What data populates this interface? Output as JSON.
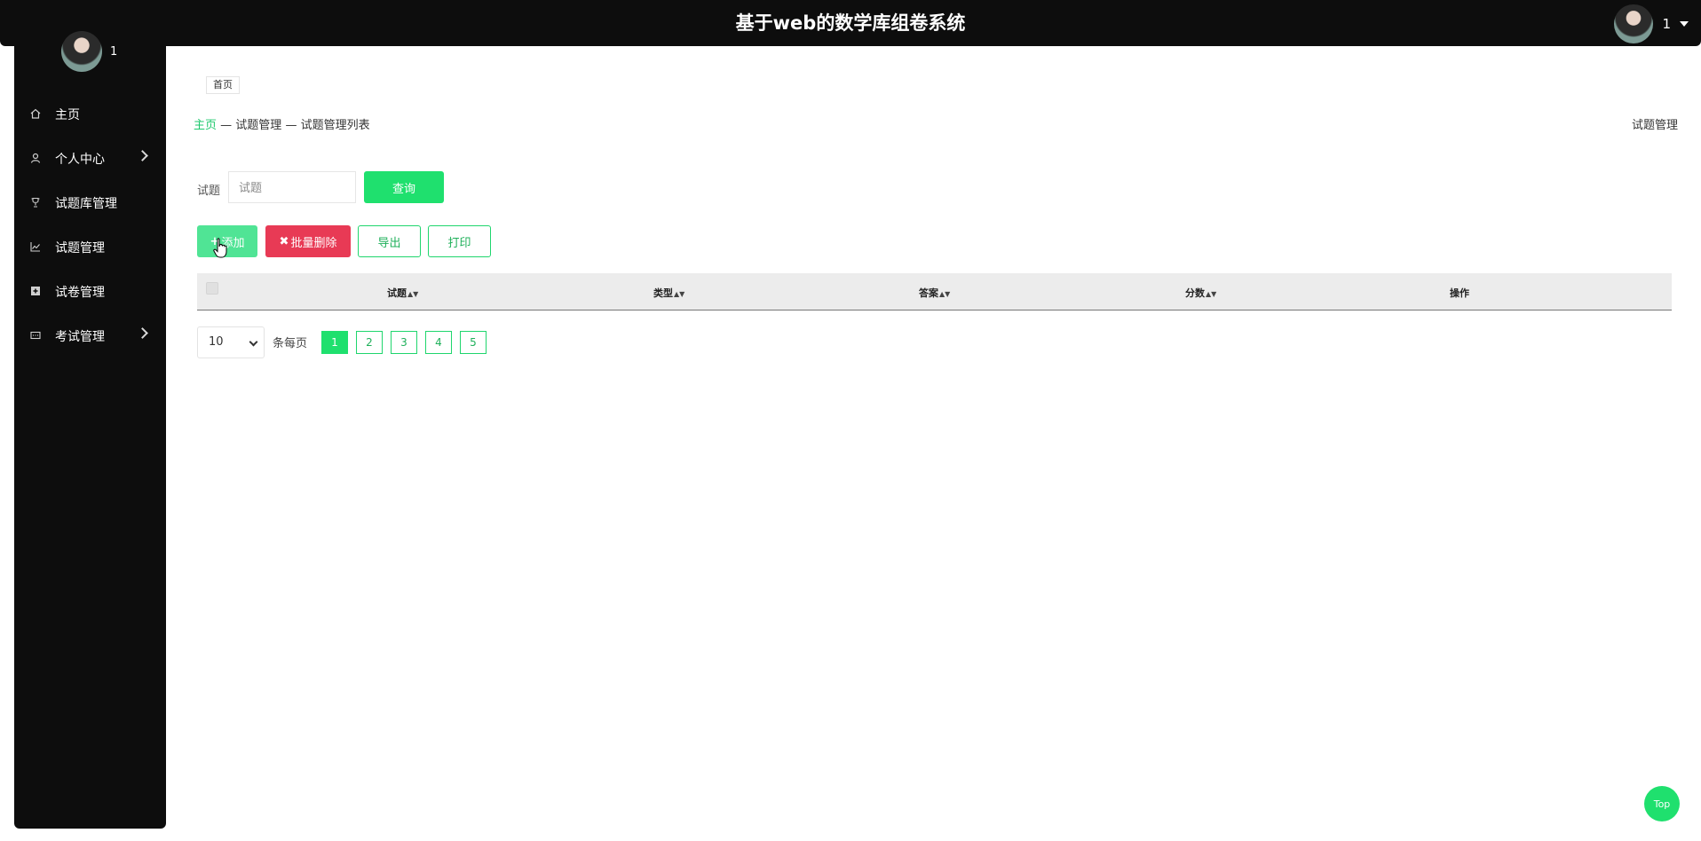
{
  "app": {
    "title": "基于web的数学库组卷系统",
    "username": "1"
  },
  "sidebar": {
    "username": "1",
    "items": [
      {
        "label": "主页",
        "icon": "home-icon",
        "expandable": false
      },
      {
        "label": "个人中心",
        "icon": "user-icon",
        "expandable": true
      },
      {
        "label": "试题库管理",
        "icon": "trophy-icon",
        "expandable": false
      },
      {
        "label": "试题管理",
        "icon": "chart-icon",
        "expandable": false
      },
      {
        "label": "试卷管理",
        "icon": "plus-square-icon",
        "expandable": false
      },
      {
        "label": "考试管理",
        "icon": "card-icon",
        "expandable": true
      }
    ]
  },
  "tabs": [
    {
      "label": "首页"
    }
  ],
  "breadcrumb": {
    "home": "主页",
    "separator1": "—",
    "level1": "试题管理",
    "separator2": "—",
    "level2": "试题管理列表"
  },
  "page_title": "试题管理",
  "search": {
    "label": "试题",
    "placeholder": "试题",
    "value": "",
    "button": "查询"
  },
  "actions": {
    "add": "添加",
    "batch_delete": "批量删除",
    "export": "导出",
    "print": "打印"
  },
  "table": {
    "columns": [
      "试题",
      "类型",
      "答案",
      "分数",
      "操作"
    ],
    "rows": []
  },
  "pagination": {
    "page_size": "10",
    "per_page_label": "条每页",
    "pages": [
      "1",
      "2",
      "3",
      "4",
      "5"
    ],
    "current": "1"
  },
  "back_to_top": "Top",
  "colors": {
    "accent_green": "#1fe06e",
    "danger_red": "#e83a55",
    "dark": "#0d0d0d"
  }
}
